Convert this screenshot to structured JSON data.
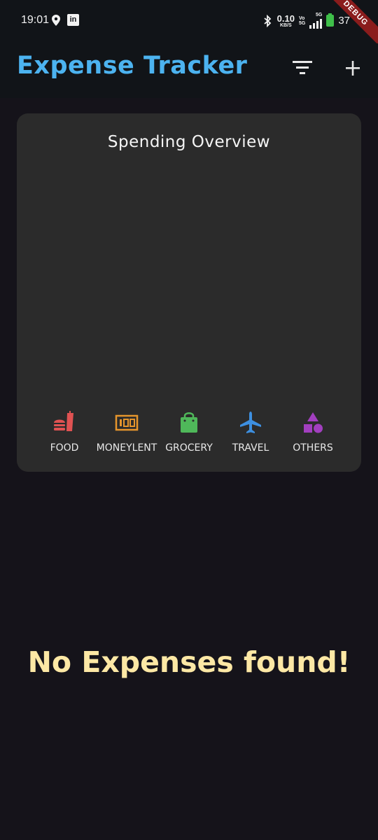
{
  "status_bar": {
    "time": "19:01",
    "network_speed_value": "0.10",
    "network_speed_unit": "KB/S",
    "volte_top": "Vo",
    "volte_bottom": "5G",
    "network_type": "5G",
    "battery": "37",
    "debug_banner": "DEBUG"
  },
  "app_bar": {
    "title": "Expense Tracker",
    "filter_icon": "filter-list-icon",
    "add_icon": "plus-icon"
  },
  "overview": {
    "title": "Spending Overview",
    "categories": [
      {
        "label": "FOOD",
        "icon": "fastfood-icon",
        "color": "#e05252"
      },
      {
        "label": "MONEYLENT",
        "icon": "money-icon",
        "color": "#e6952c"
      },
      {
        "label": "GROCERY",
        "icon": "shopping-bag-icon",
        "color": "#4fb85a"
      },
      {
        "label": "TRAVEL",
        "icon": "airplane-icon",
        "color": "#3d8fe0"
      },
      {
        "label": "OTHERS",
        "icon": "category-icon",
        "color": "#a23fbf"
      }
    ]
  },
  "empty_state": {
    "message": "No Expenses found!"
  },
  "colors": {
    "background": "#15131a",
    "app_bar": "#111418",
    "title_accent": "#4cb3f0",
    "card": "#2b2b2b",
    "empty_text": "#fde8a5"
  }
}
